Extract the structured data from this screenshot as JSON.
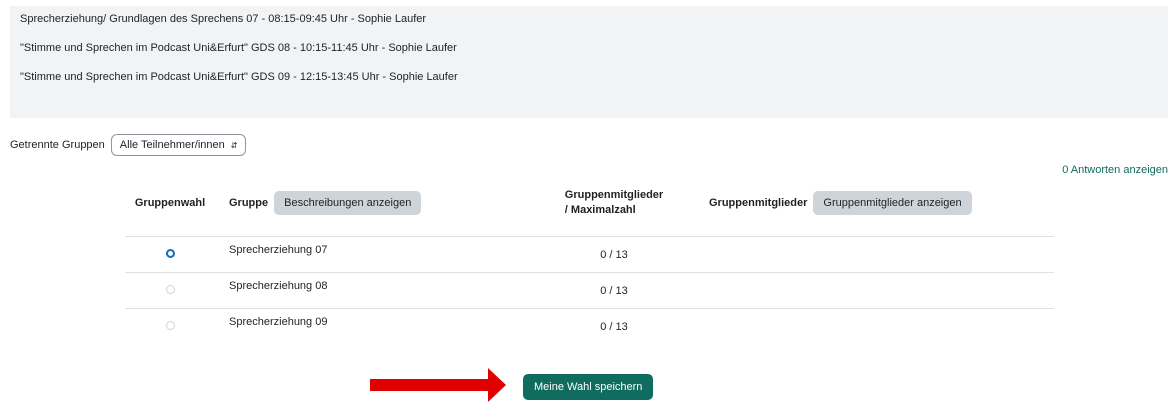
{
  "description": {
    "lines": [
      "Sprecherziehung/ Grundlagen des Sprechens 07 - 08:15-09:45 Uhr - Sophie Laufer",
      "\"Stimme und Sprechen im Podcast Uni&Erfurt\" GDS 08 - 10:15-11:45 Uhr - Sophie Laufer",
      "\"Stimme und Sprechen im Podcast Uni&Erfurt\" GDS 09 - 12:15-13:45 Uhr - Sophie Laufer"
    ]
  },
  "group_mode": {
    "label": "Getrennte Gruppen",
    "selected": "Alle Teilnehmer/innen"
  },
  "responses_link": "0 Antworten anzeigen",
  "table": {
    "headers": {
      "choice": "Gruppenwahl",
      "group": "Gruppe",
      "show_descriptions": "Beschreibungen anzeigen",
      "count_line1": "Gruppenmitglieder",
      "count_line2": "/ Maximalzahl",
      "members": "Gruppenmitglieder",
      "show_members": "Gruppenmitglieder anzeigen"
    },
    "rows": [
      {
        "name": "Sprecherziehung 07",
        "count": "0 / 13",
        "checked": true
      },
      {
        "name": "Sprecherziehung 08",
        "count": "0 / 13",
        "checked": false
      },
      {
        "name": "Sprecherziehung 09",
        "count": "0 / 13",
        "checked": false
      }
    ]
  },
  "save_button": "Meine Wahl speichern",
  "colors": {
    "primary_green": "#0f6c5f",
    "radio_blue": "#0f6cbf",
    "arrow_red": "#e00000",
    "panel_grey": "#f2f3f4"
  }
}
